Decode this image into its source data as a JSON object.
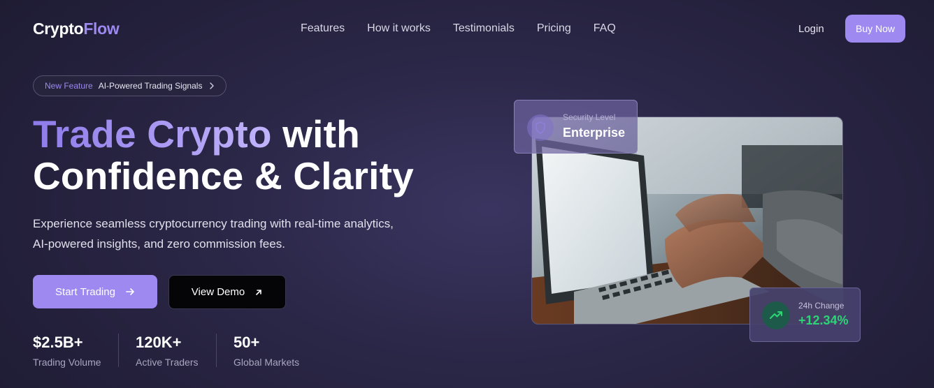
{
  "logo": {
    "part1": "Crypto",
    "part2": "Flow"
  },
  "nav": {
    "items": [
      "Features",
      "How it works",
      "Testimonials",
      "Pricing",
      "FAQ"
    ]
  },
  "header": {
    "login": "Login",
    "buy": "Buy Now"
  },
  "badge": {
    "tag": "New Feature",
    "text": "AI-Powered Trading Signals"
  },
  "hero": {
    "title_grad": "Trade Crypto",
    "title_rest": " with",
    "title_line2": "Confidence & Clarity",
    "subtitle": "Experience seamless cryptocurrency trading with real-time analytics, AI-powered insights, and zero commission fees."
  },
  "buttons": {
    "start": "Start Trading",
    "demo": "View Demo"
  },
  "stats": [
    {
      "value": "$2.5B+",
      "label": "Trading Volume"
    },
    {
      "value": "120K+",
      "label": "Active Traders"
    },
    {
      "value": "50+",
      "label": "Global Markets"
    }
  ],
  "security_card": {
    "label": "Security Level",
    "value": "Enterprise"
  },
  "change_card": {
    "label": "24h Change",
    "value": "+12.34%"
  },
  "colors": {
    "accent": "#9d89f0",
    "positive": "#2bd576"
  }
}
